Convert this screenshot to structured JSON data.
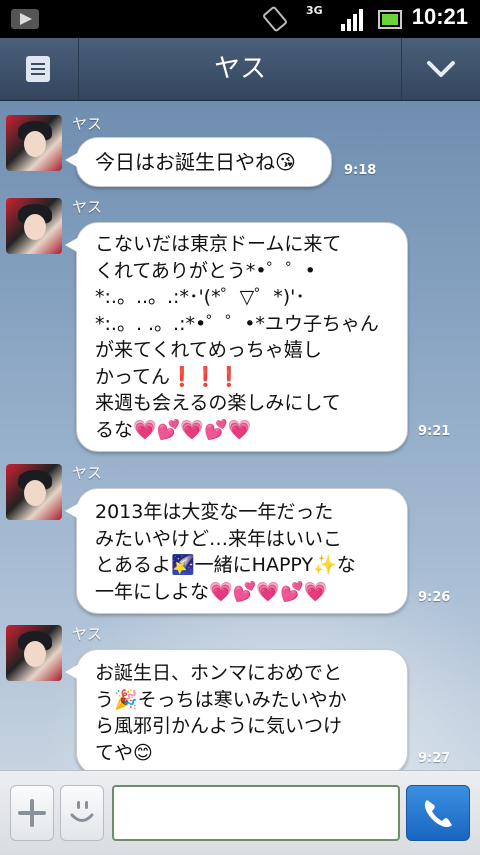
{
  "status_bar": {
    "network": "3G",
    "time": "10:21"
  },
  "header": {
    "title": "ヤス"
  },
  "messages": [
    {
      "sender": "ヤス",
      "text": "今日はお誕生日やね😘",
      "time": "9:18"
    },
    {
      "sender": "ヤス",
      "text": "こないだは東京ドームに来て\nくれてありがとう*•゜゜•\n*:.。..。.:*･'(*゜▽゜*)'･\n*:.。. .。.:*•゜゜•*ユウ子ちゃん\nが来てくれてめっちゃ嬉し\nかってん❗️❗️❗️\n来週も会えるの楽しみにして\nるな💗💕💗💕💗",
      "time": "9:21"
    },
    {
      "sender": "ヤス",
      "text": "2013年は大変な一年だった\nみたいやけど…来年はいいこ\nとあるよ🌠一緒にHAPPY✨な\n一年にしよな💗💕💗💕💗",
      "time": "9:26"
    },
    {
      "sender": "ヤス",
      "text": "お誕生日、ホンマにおめでと\nう🎉そっちは寒いみたいやか\nら風邪引かんように気いつけ\nてや😊",
      "time": "9:27"
    }
  ],
  "input_bar": {
    "placeholder": ""
  }
}
